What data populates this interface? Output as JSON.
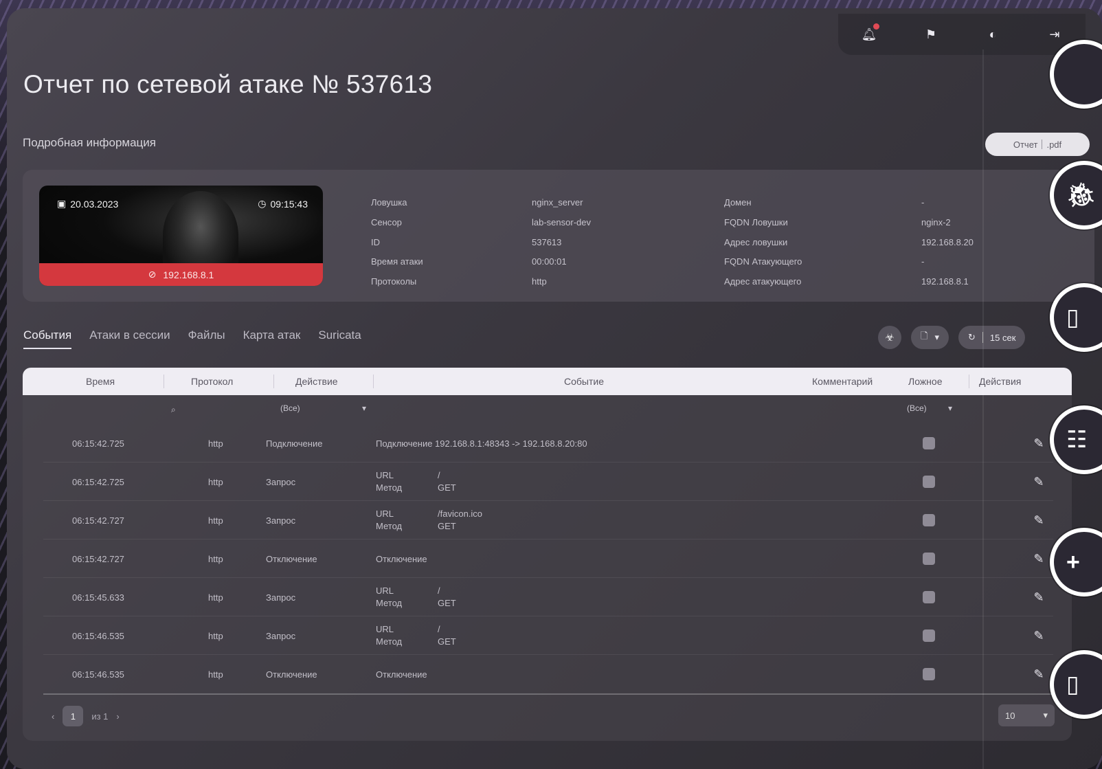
{
  "header": {
    "title": "Отчет по сетевой атаке № 537613",
    "subtitle": "Подробная информация",
    "pdf_button": {
      "left": "Отчет",
      "right": ".pdf"
    }
  },
  "topbar_icons": [
    "bell-icon",
    "flag-icon",
    "theme-icon",
    "logout-icon"
  ],
  "notification_dot_color": "#e04a55",
  "attack_card": {
    "date": "20.03.2023",
    "time": "09:15:43",
    "attacker_ip": "192.168.8.1",
    "accent_color": "#d4383e",
    "fields_left": [
      {
        "label": "Ловушка",
        "value": "nginx_server"
      },
      {
        "label": "Сенсор",
        "value": "lab-sensor-dev"
      },
      {
        "label": "ID",
        "value": "537613"
      },
      {
        "label": "Время атаки",
        "value": "00:00:01"
      },
      {
        "label": "Протоколы",
        "value": "http"
      }
    ],
    "fields_right": [
      {
        "label": "Домен",
        "value": "-"
      },
      {
        "label": "FQDN Ловушки",
        "value": "nginx-2"
      },
      {
        "label": "Адрес ловушки",
        "value": "192.168.8.20"
      },
      {
        "label": "FQDN Атакующего",
        "value": "-"
      },
      {
        "label": "Адрес атакующего",
        "value": "192.168.8.1"
      }
    ]
  },
  "tabs": [
    {
      "label": "События",
      "active": true
    },
    {
      "label": "Атаки в сессии",
      "active": false
    },
    {
      "label": "Файлы",
      "active": false
    },
    {
      "label": "Карта атак",
      "active": false
    },
    {
      "label": "Suricata",
      "active": false
    }
  ],
  "toolbar": {
    "refresh_interval": "15 сек"
  },
  "table": {
    "columns": [
      "Время",
      "Протокол",
      "Действие",
      "Событие",
      "Комментарий",
      "Ложное",
      "Действия"
    ],
    "filters": {
      "action": "(Все)",
      "false_flag": "(Все)"
    },
    "rows": [
      {
        "time": "06:15:42.725",
        "protocol": "http",
        "action": "Подключение",
        "event_text": "Подключение 192.168.8.1:48343 -> 192.168.8.20:80"
      },
      {
        "time": "06:15:42.725",
        "protocol": "http",
        "action": "Запрос",
        "url": "/",
        "method": "GET"
      },
      {
        "time": "06:15:42.727",
        "protocol": "http",
        "action": "Запрос",
        "url": "/favicon.ico",
        "method": "GET"
      },
      {
        "time": "06:15:42.727",
        "protocol": "http",
        "action": "Отключение",
        "event_text": "Отключение"
      },
      {
        "time": "06:15:45.633",
        "protocol": "http",
        "action": "Запрос",
        "url": "/",
        "method": "GET"
      },
      {
        "time": "06:15:46.535",
        "protocol": "http",
        "action": "Запрос",
        "url": "/",
        "method": "GET"
      },
      {
        "time": "06:15:46.535",
        "protocol": "http",
        "action": "Отключение",
        "event_text": "Отключение"
      }
    ],
    "url_label": "URL",
    "method_label": "Метод"
  },
  "pagination": {
    "current": "1",
    "of_text": "из 1",
    "page_size": "10"
  }
}
